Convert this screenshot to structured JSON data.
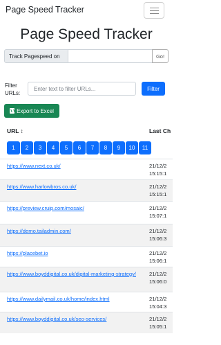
{
  "navbar": {
    "brand": "Page Speed Tracker"
  },
  "title": "Page Speed Tracker",
  "track": {
    "label": "Track Pagespeed on",
    "value": "",
    "button": "Go!"
  },
  "filter": {
    "label": "Filter URLs:",
    "placeholder": "Enter text to filter URLs...",
    "button": "Filter"
  },
  "export": {
    "label": "Export to Excel",
    "icon": "file-excel-icon"
  },
  "table": {
    "columns": [
      "URL",
      "Last Ch"
    ],
    "sort_glyph": "↕",
    "pages": [
      "1",
      "2",
      "3",
      "4",
      "5",
      "6",
      "7",
      "8",
      "9",
      "10",
      "11"
    ],
    "rows": [
      {
        "url": "https://www.next.co.uk/",
        "date": "21/12/2",
        "time": "15:15:1"
      },
      {
        "url": "https://www.harlowbros.co.uk/",
        "date": "21/12/2",
        "time": "15:15:1"
      },
      {
        "url": "https://preview.cruip.com/mosaic/",
        "date": "21/12/2",
        "time": "15:07:1"
      },
      {
        "url": "https://demo.tailadmin.com/",
        "date": "21/12/2",
        "time": "15:06:3"
      },
      {
        "url": "https://placebet.io",
        "date": "21/12/2",
        "time": "15:06:1"
      },
      {
        "url": "https://www.boyddigital.co.uk/digital-marketing-strategy/",
        "date": "21/12/2",
        "time": "15:06:0"
      },
      {
        "url": "https://www.dailymail.co.uk/home/index.html",
        "date": "21/12/2",
        "time": "15:04:3"
      },
      {
        "url": "https://www.boyddigital.co.uk/seo-services/",
        "date": "21/12/2",
        "time": "15:05:1"
      }
    ]
  },
  "colors": {
    "primary": "#0d6efd",
    "success": "#198754",
    "stripe": "#f2f2f2"
  }
}
